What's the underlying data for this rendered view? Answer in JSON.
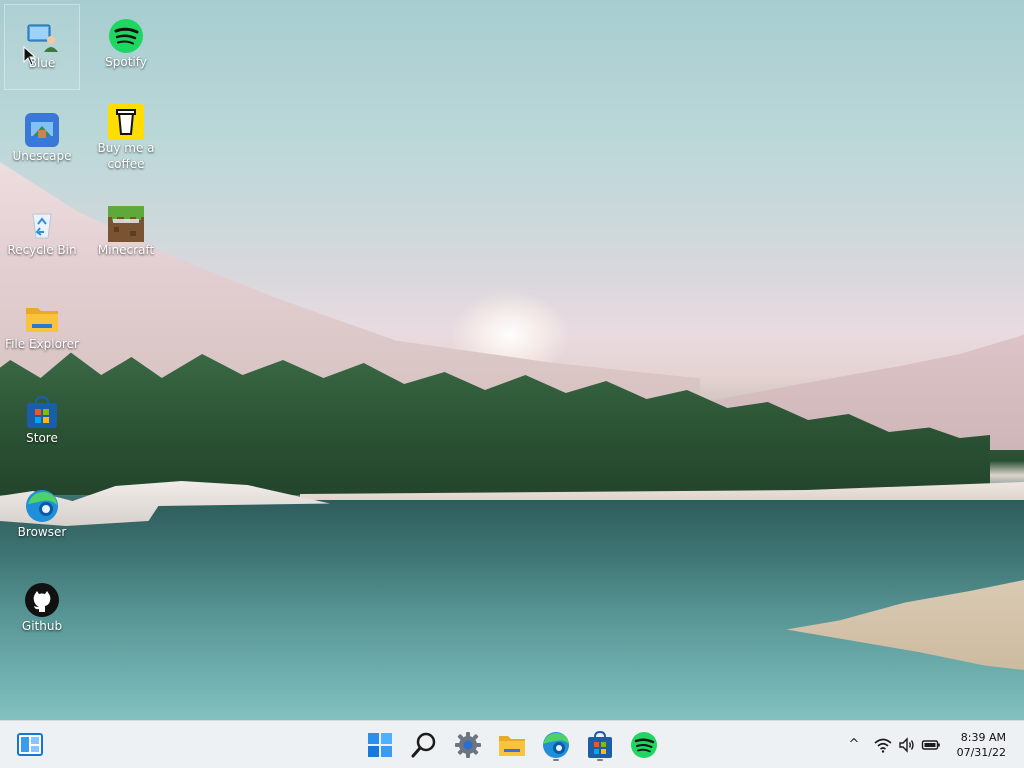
{
  "desktop": {
    "icons": [
      {
        "label": "Blue",
        "icon": "user-computer-icon"
      },
      {
        "label": "Spotify",
        "icon": "spotify-icon"
      },
      {
        "label": "Unescape",
        "icon": "unescape-game-icon"
      },
      {
        "label": "Buy me a coffee",
        "icon": "coffee-cup-icon"
      },
      {
        "label": "Recycle Bin",
        "icon": "recycle-bin-icon"
      },
      {
        "label": "Minecraft",
        "icon": "minecraft-icon"
      },
      {
        "label": "File Explorer",
        "icon": "folder-icon"
      },
      {
        "label": "Store",
        "icon": "store-bag-icon"
      },
      {
        "label": "Browser",
        "icon": "edge-browser-icon"
      },
      {
        "label": "Github",
        "icon": "github-icon"
      }
    ]
  },
  "taskbar": {
    "pinned": [
      {
        "name": "Widgets",
        "icon": "widgets-icon"
      },
      {
        "name": "Start",
        "icon": "windows-start-icon"
      },
      {
        "name": "Search",
        "icon": "search-icon"
      },
      {
        "name": "Settings",
        "icon": "gear-icon"
      },
      {
        "name": "File Explorer",
        "icon": "folder-icon"
      },
      {
        "name": "Browser",
        "icon": "edge-browser-icon"
      },
      {
        "name": "Store",
        "icon": "store-bag-icon"
      },
      {
        "name": "Spotify",
        "icon": "spotify-icon"
      }
    ],
    "tray": {
      "chevron": "^",
      "icons": [
        "wifi-icon",
        "speaker-icon",
        "battery-icon"
      ]
    },
    "clock": {
      "time": "8:39 AM",
      "date": "07/31/22"
    }
  },
  "colors": {
    "spotify_green": "#1ed760",
    "coffee_yellow": "#ffdd00",
    "folder_yellow": "#f9c33b",
    "store_blue": "#1a5dab",
    "edge_blue": "#1f8fd8",
    "windows_blue": "#0078d4",
    "taskbar_bg": "#eceff3"
  }
}
